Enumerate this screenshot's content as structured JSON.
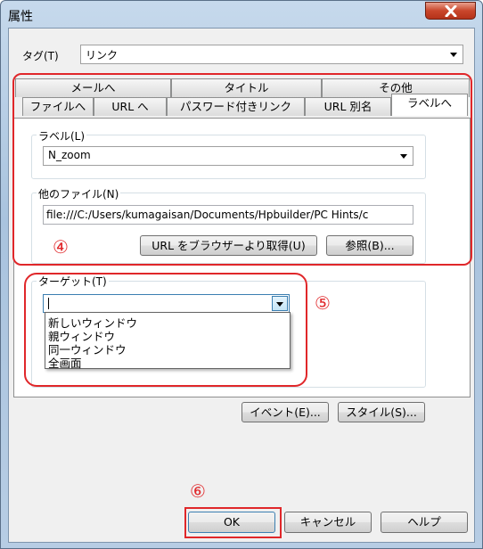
{
  "window": {
    "title": "属性"
  },
  "tag": {
    "label": "タグ(T)",
    "value": "リンク"
  },
  "tabs": {
    "row1": [
      "メールへ",
      "タイトル",
      "その他"
    ],
    "row2": [
      "ファイルへ",
      "URL へ",
      "パスワード付きリンク",
      "URL 別名",
      "ラベルへ"
    ]
  },
  "label_group": {
    "title": "ラベル(L)",
    "value": "N_zoom"
  },
  "other_file_group": {
    "title": "他のファイル(N)",
    "value": "file:///C:/Users/kumagaisan/Documents/Hpbuilder/PC Hints/c",
    "url_button": "URL をブラウザーより取得(U)",
    "browse_button": "参照(B)..."
  },
  "target_group": {
    "title": "ターゲット(T)",
    "value": "",
    "options": [
      "新しいウィンドウ",
      "親ウィンドウ",
      "同一ウィンドウ",
      "全画面"
    ]
  },
  "event_button": "イベント(E)...",
  "style_button": "スタイル(S)...",
  "footer": {
    "ok": "OK",
    "cancel": "キャンセル",
    "help": "ヘルプ"
  },
  "annotations": {
    "four": "④",
    "five": "⑤",
    "six": "⑥"
  },
  "colors": {
    "annotation": "#e0272a",
    "titlebar": "#b7cde4",
    "close_button": "#c9462b"
  }
}
